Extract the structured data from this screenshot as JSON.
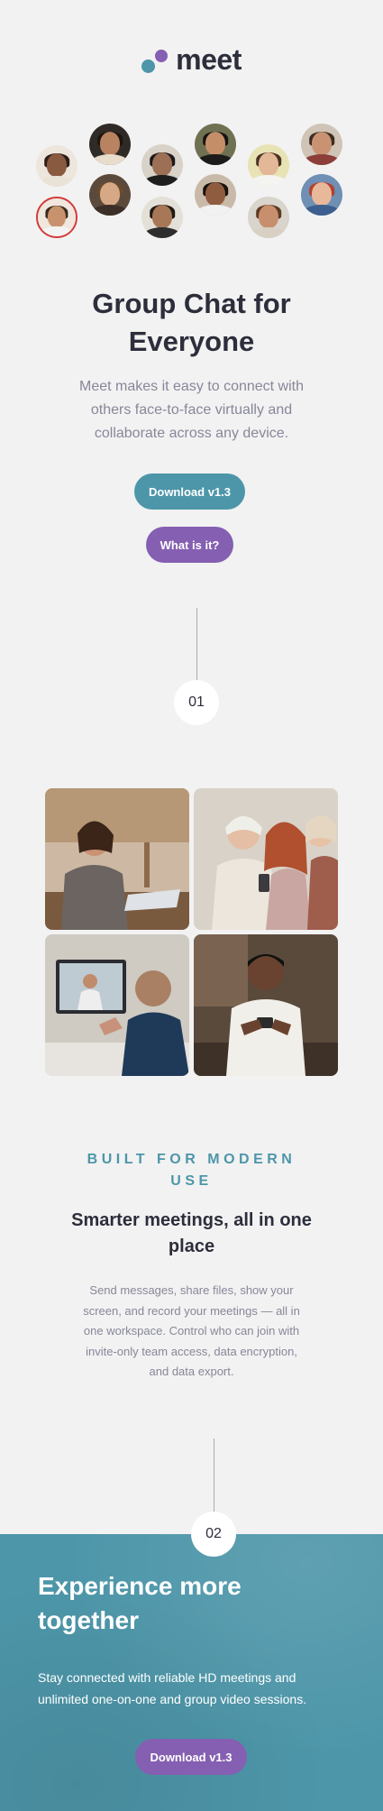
{
  "brand": {
    "name": "meet",
    "colors": {
      "teal": "#4d96a9",
      "purple": "#855fb1",
      "dark": "#2d2e3c",
      "gray": "#87879a"
    }
  },
  "hero": {
    "title": "Group Chat for Everyone",
    "text": "Meet makes it easy to connect with others face-to-face virtually and collaborate across any device.",
    "download_label": "Download v1.3",
    "whatis_label": "What is it?"
  },
  "steps": {
    "one": "01",
    "two": "02"
  },
  "features": {
    "eyebrow": "BUILT FOR MODERN USE",
    "title": "Smarter meetings, all in one place",
    "text": "Send messages, share files, show your screen, and record your meetings — all in one workspace. Control who can join with invite-only team access, data encryption, and data export."
  },
  "footer": {
    "title": "Experience more together",
    "text": "Stay connected with reliable HD meetings and unlimited one-on-one and group video sessions.",
    "download_label": "Download v1.3"
  }
}
